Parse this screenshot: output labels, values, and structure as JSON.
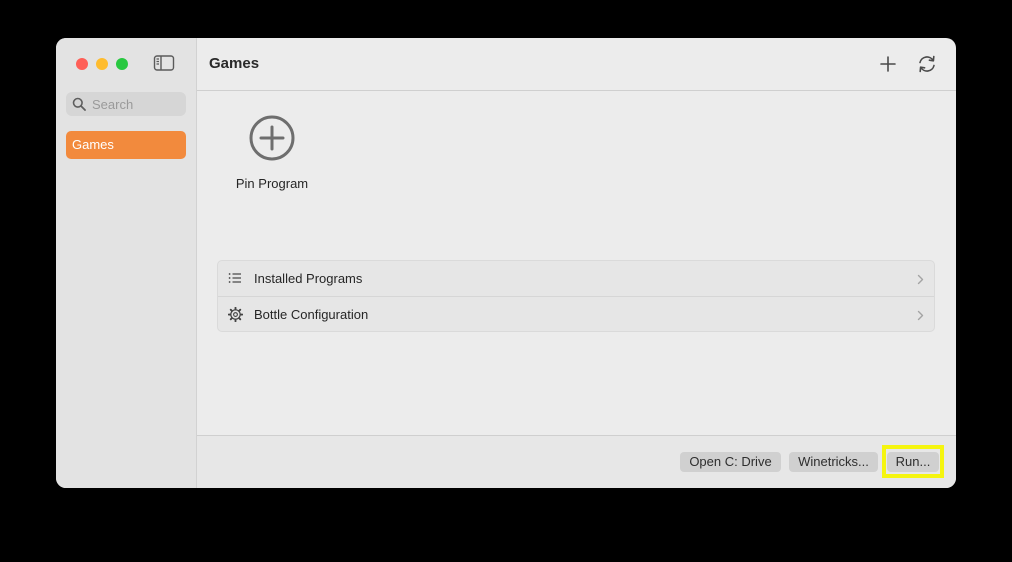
{
  "sidebar": {
    "search_placeholder": "Search",
    "items": [
      {
        "label": "Games",
        "selected": true
      }
    ]
  },
  "header": {
    "title": "Games"
  },
  "main": {
    "pin": {
      "label": "Pin Program"
    },
    "list": [
      {
        "label": "Installed Programs",
        "icon": "list-icon"
      },
      {
        "label": "Bottle Configuration",
        "icon": "gear-icon"
      }
    ]
  },
  "footer": {
    "buttons": [
      {
        "label": "Open C: Drive"
      },
      {
        "label": "Winetricks..."
      },
      {
        "label": "Run..."
      }
    ]
  },
  "colors": {
    "accent": "#f28a3d",
    "highlight": "#f5f50f"
  }
}
